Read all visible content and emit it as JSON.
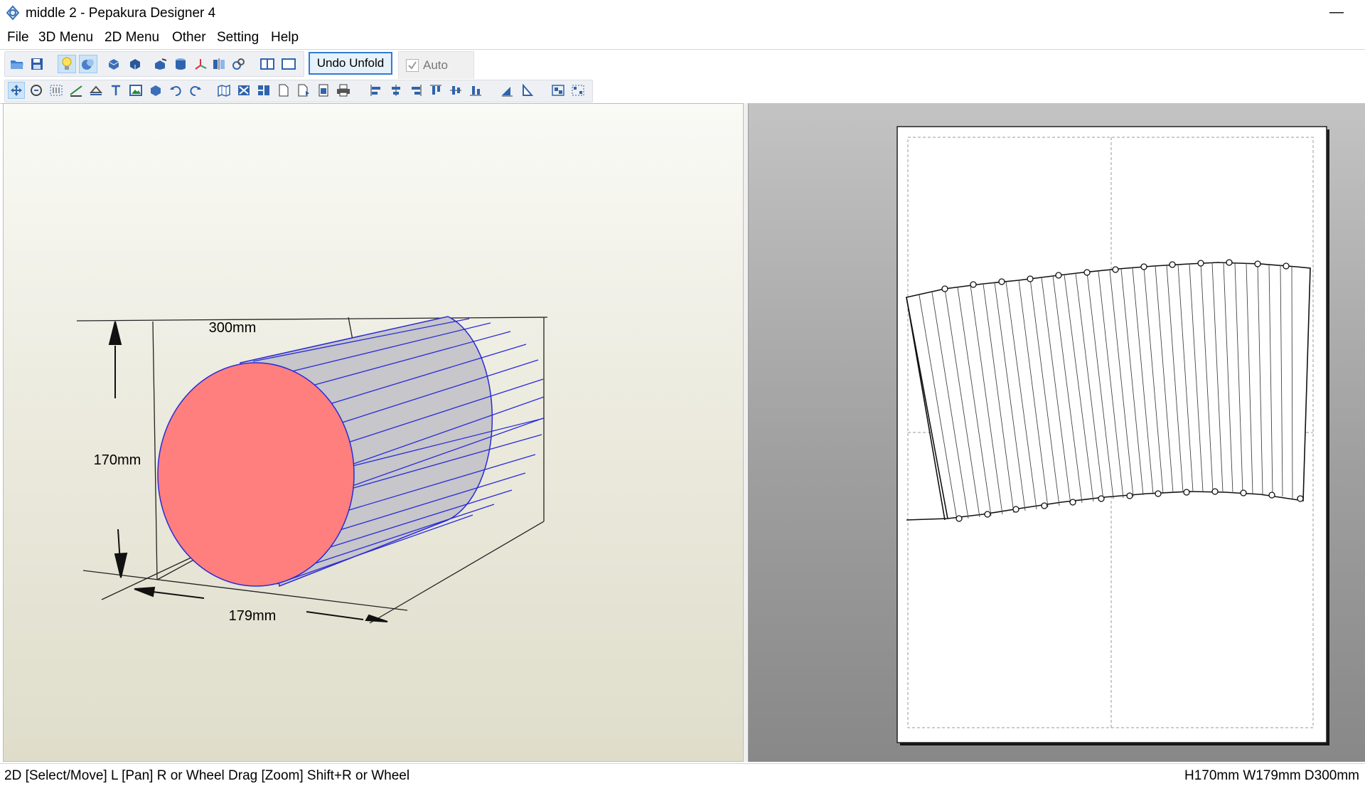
{
  "window": {
    "title": "middle 2 - Pepakura Designer 4",
    "minimize_glyph": "—"
  },
  "menu": {
    "items": [
      "File",
      "3D Menu",
      "2D Menu",
      "Other",
      "Setting",
      "Help"
    ]
  },
  "toolbar": {
    "undo_unfold_label": "Undo Unfold",
    "auto_label": "Auto",
    "auto_checked": true,
    "icons_row1": [
      "open-icon",
      "save-icon",
      "lightbulb-icon",
      "texture-icon",
      "rotate-model-icon",
      "rotate-model-alt-icon",
      "edit-icon",
      "cylinder-icon",
      "axis-icon",
      "mirror-icon",
      "link-icon",
      "two-views-icon",
      "single-view-icon"
    ],
    "icons_row2": [
      "select-move-icon",
      "pan-icon",
      "join-icon",
      "fold-line-icon",
      "flap-icon",
      "text-icon",
      "image-icon",
      "box-icon",
      "undo-icon",
      "redo-icon",
      "unfold-icon",
      "arrange-icon",
      "layout-icon",
      "page-icon",
      "page-add-icon",
      "page-setting-icon",
      "print-icon",
      "align-left-icon",
      "align-center-icon",
      "align-right-icon",
      "align-top-icon",
      "align-middle-icon",
      "align-bottom-icon",
      "flip-h-icon",
      "flip-v-icon",
      "group-icon",
      "ungroup-icon"
    ]
  },
  "view3d": {
    "dimension_depth": "300mm",
    "dimension_height": "170mm",
    "dimension_width": "179mm",
    "end_cap_color": "#ff7f7f",
    "edge_color": "#2a2ad6",
    "body_color": "#c8c8cc"
  },
  "view2d": {
    "paper_color": "#ffffff"
  },
  "status": {
    "hint": "2D [Select/Move] L [Pan] R or Wheel Drag [Zoom] Shift+R or Wheel",
    "dimensions": "H170mm W179mm D300mm"
  }
}
